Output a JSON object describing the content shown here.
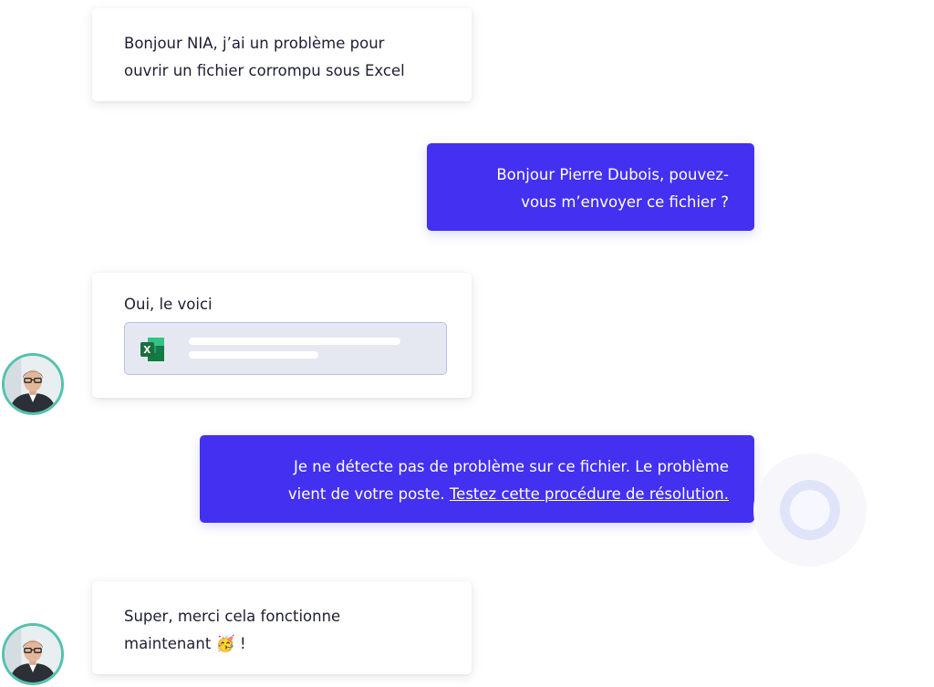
{
  "messages": {
    "user_1": {
      "line1": "Bonjour NIA, j’ai un problème pour",
      "line2": "ouvrir un fichier corrompu sous Excel"
    },
    "bot_1": {
      "line1": "Bonjour Pierre Dubois, pouvez-",
      "line2": "vous m’envoyer ce fichier ?"
    },
    "user_2": {
      "text": "Oui, le voici",
      "attachment_icon": "excel-icon"
    },
    "bot_2": {
      "line1": "Je ne détecte pas de problème sur ce fichier. Le problème",
      "line2": "vient de votre poste.",
      "link": "Testez cette procédure de résolution."
    },
    "user_3": {
      "line1": "Super, merci cela fonctionne",
      "line2": "maintenant",
      "emoji": "🥳",
      "line2_end": "!"
    }
  },
  "colors": {
    "bot_bubble": "#4330f0",
    "avatar_ring": "#54c2ae",
    "excel_green": "#1f7a43"
  }
}
